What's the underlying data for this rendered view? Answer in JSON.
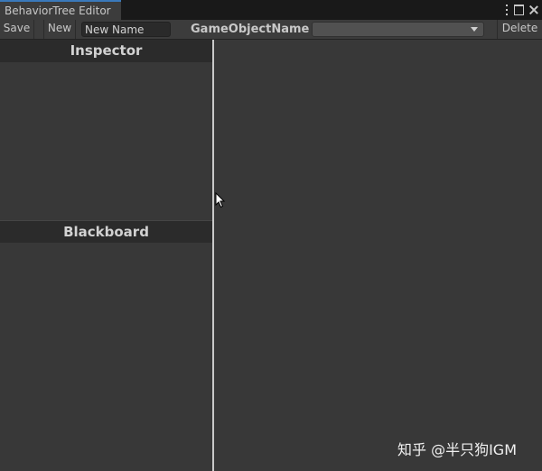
{
  "window": {
    "tab_title": "BehaviorTree Editor",
    "controls": [
      "kebab-menu-icon",
      "maximize-icon",
      "close-icon"
    ]
  },
  "toolbar": {
    "save_label": "Save",
    "new_label": "New",
    "name_value": "New Name",
    "gameobject_label": "GameObjectName",
    "gameobject_selected": "",
    "delete_label": "Delete"
  },
  "left_pane": {
    "inspector_title": "Inspector",
    "blackboard_title": "Blackboard"
  },
  "watermark": "知乎 @半只狗IGM",
  "colors": {
    "background": "#383838",
    "tab_accent": "#3a79bb",
    "header_bg": "#2b2b2b",
    "splitter": "#c9c9c9"
  }
}
